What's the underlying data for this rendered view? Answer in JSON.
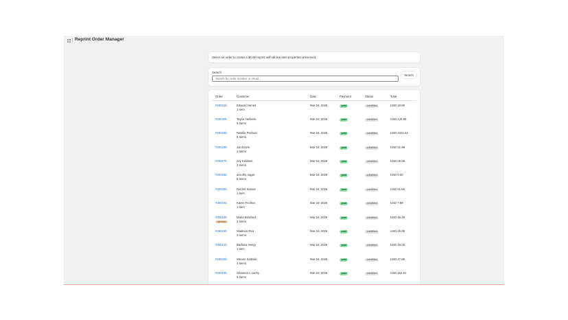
{
  "app": {
    "title": "Reprint Order Manager"
  },
  "info": {
    "text": "Select an order to create a $0.00 reprint with all line item properties preserved."
  },
  "search": {
    "label": "Search",
    "placeholder": "Search by order number or email...",
    "value": "",
    "button_label": "Search"
  },
  "table": {
    "headers": {
      "order": "Order",
      "customer": "Customer",
      "date": "Date",
      "payment": "Payment",
      "status": "Status",
      "total": "Total"
    },
    "rows": [
      {
        "order": "#30031b",
        "customer": "Edward Henelt",
        "items": "1 item",
        "date": "Mar 24, 2026",
        "payment": "paid",
        "status": "unfulfilled",
        "total": "USD 18.99"
      },
      {
        "order": "#30030b",
        "customer": "Taylor Heiberle",
        "items": "5 items",
        "date": "Mar 24, 2026",
        "payment": "paid",
        "status": "unfulfilled",
        "total": "USD 133.99"
      },
      {
        "order": "#30029b",
        "customer": "Natalie Pavlovic",
        "items": "5 items",
        "date": "Mar 24, 2026",
        "payment": "paid",
        "status": "unfulfilled",
        "total": "USD 3421.62"
      },
      {
        "order": "#30028b",
        "customer": "Jan Davis",
        "items": "4 items",
        "date": "Mar 24, 2026",
        "payment": "paid",
        "status": "unfulfilled",
        "total": "USD 31.99"
      },
      {
        "order": "#30027b",
        "customer": "Joy Keldsen",
        "items": "2 items",
        "date": "Mar 24, 2026",
        "payment": "paid",
        "status": "unfulfilled",
        "total": "USD 28.59"
      },
      {
        "order": "#30026b",
        "customer": "dorothy sagar",
        "items": "5 items",
        "date": "Mar 24, 2026",
        "payment": "paid",
        "status": "unfulfilled",
        "total": "USD 0.00"
      },
      {
        "order": "#30025b",
        "customer": "Rachel Sasser",
        "items": "1 item",
        "date": "Mar 24, 2026",
        "payment": "paid",
        "status": "unfulfilled",
        "total": "USD 61.55"
      },
      {
        "order": "#30024b",
        "customer": "Karen Fechter",
        "items": "1 item",
        "date": "Mar 24, 2026",
        "payment": "paid",
        "status": "unfulfilled",
        "total": "USD 7.99"
      },
      {
        "order": "#30023b",
        "customer": "Marie Botsford",
        "items": "2 items",
        "date": "Mar 24, 2026",
        "payment": "paid",
        "status": "unfulfilled",
        "total": "USD 46.49",
        "tag": "reprinted"
      },
      {
        "order": "#30022b",
        "customer": "Madison Rea",
        "items": "3 items",
        "date": "Mar 24, 2026",
        "payment": "paid",
        "status": "unfulfilled",
        "total": "USD 46.99"
      },
      {
        "order": "#30021b",
        "customer": "Barbara Henry",
        "items": "1 item",
        "date": "Mar 24, 2026",
        "payment": "paid",
        "status": "unfulfilled",
        "total": "USD 19.05"
      },
      {
        "order": "#30020b",
        "customer": "Steven Kaltsaki",
        "items": "4 items",
        "date": "Mar 24, 2026",
        "payment": "paid",
        "status": "unfulfilled",
        "total": "USD 37.89"
      },
      {
        "order": "#30019b",
        "customer": "Shannon L Litchy",
        "items": "5 items",
        "date": "Mar 24, 2026",
        "payment": "paid",
        "status": "unfulfilled",
        "total": "USD 154.61"
      }
    ]
  },
  "colors": {
    "link": "#2c6ecb",
    "paid_badge": "#91e5a8",
    "status_badge": "#e3e3e3",
    "reprinted_badge": "#f0d6b8"
  }
}
